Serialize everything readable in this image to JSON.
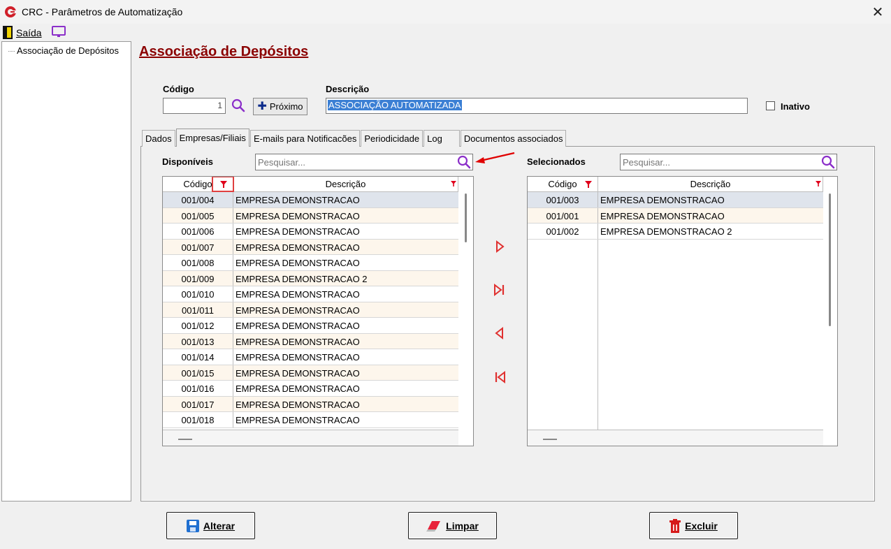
{
  "window": {
    "title": "CRC - Parâmetros de Automatização",
    "close_glyph": "✕"
  },
  "menu": {
    "exit_label": "Saída",
    "icons": [
      "exit-door-icon",
      "monitor-icon"
    ]
  },
  "tree": {
    "items": [
      {
        "label": "Associação de Depósitos"
      }
    ]
  },
  "page": {
    "heading": "Associação de Depósitos"
  },
  "form": {
    "codigo_label": "Código",
    "codigo_value": "1",
    "proximo_label": "Próximo",
    "descricao_label": "Descrição",
    "descricao_value": "ASSOCIAÇÃO AUTOMATIZADA",
    "inativo_label": "Inativo",
    "inativo_checked": false
  },
  "tabs": [
    {
      "label": "Dados",
      "active": false
    },
    {
      "label": "Empresas/Filiais",
      "active": true
    },
    {
      "label": "E-mails para Notificacões",
      "active": false
    },
    {
      "label": "Periodicidade",
      "active": false
    },
    {
      "label": "Log",
      "active": false
    },
    {
      "label": "Documentos associados",
      "active": false
    }
  ],
  "available": {
    "label": "Disponíveis",
    "search_placeholder": "Pesquisar...",
    "columns": [
      "Código",
      "Descrição"
    ],
    "rows": [
      {
        "codigo": "001/004",
        "descricao": "EMPRESA DEMONSTRACAO"
      },
      {
        "codigo": "001/005",
        "descricao": "EMPRESA DEMONSTRACAO"
      },
      {
        "codigo": "001/006",
        "descricao": "EMPRESA DEMONSTRACAO"
      },
      {
        "codigo": "001/007",
        "descricao": "EMPRESA DEMONSTRACAO"
      },
      {
        "codigo": "001/008",
        "descricao": "EMPRESA DEMONSTRACAO"
      },
      {
        "codigo": "001/009",
        "descricao": "EMPRESA DEMONSTRACAO 2"
      },
      {
        "codigo": "001/010",
        "descricao": "EMPRESA DEMONSTRACAO"
      },
      {
        "codigo": "001/011",
        "descricao": "EMPRESA DEMONSTRACAO"
      },
      {
        "codigo": "001/012",
        "descricao": "EMPRESA DEMONSTRACAO"
      },
      {
        "codigo": "001/013",
        "descricao": "EMPRESA DEMONSTRACAO"
      },
      {
        "codigo": "001/014",
        "descricao": "EMPRESA DEMONSTRACAO"
      },
      {
        "codigo": "001/015",
        "descricao": "EMPRESA DEMONSTRACAO"
      },
      {
        "codigo": "001/016",
        "descricao": "EMPRESA DEMONSTRACAO"
      },
      {
        "codigo": "001/017",
        "descricao": "EMPRESA DEMONSTRACAO"
      },
      {
        "codigo": "001/018",
        "descricao": "EMPRESA DEMONSTRACAO"
      }
    ]
  },
  "selected": {
    "label": "Selecionados",
    "search_placeholder": "Pesquisar...",
    "columns": [
      "Código",
      "Descrição"
    ],
    "rows": [
      {
        "codigo": "001/003",
        "descricao": "EMPRESA DEMONSTRACAO"
      },
      {
        "codigo": "001/001",
        "descricao": "EMPRESA DEMONSTRACAO"
      },
      {
        "codigo": "001/002",
        "descricao": "EMPRESA DEMONSTRACAO 2"
      }
    ]
  },
  "transfer_icons": [
    "move-right-icon",
    "move-all-right-icon",
    "move-left-icon",
    "move-all-left-icon"
  ],
  "buttons": {
    "alterar": "Alterar",
    "limpar": "Limpar",
    "excluir": "Excluir"
  },
  "colors": {
    "heading": "#8b0000",
    "accent_purple": "#8b2fc9",
    "filter_red": "#e0001b",
    "transfer_red": "#e0302f",
    "selection_blue": "#3b7fd4"
  }
}
